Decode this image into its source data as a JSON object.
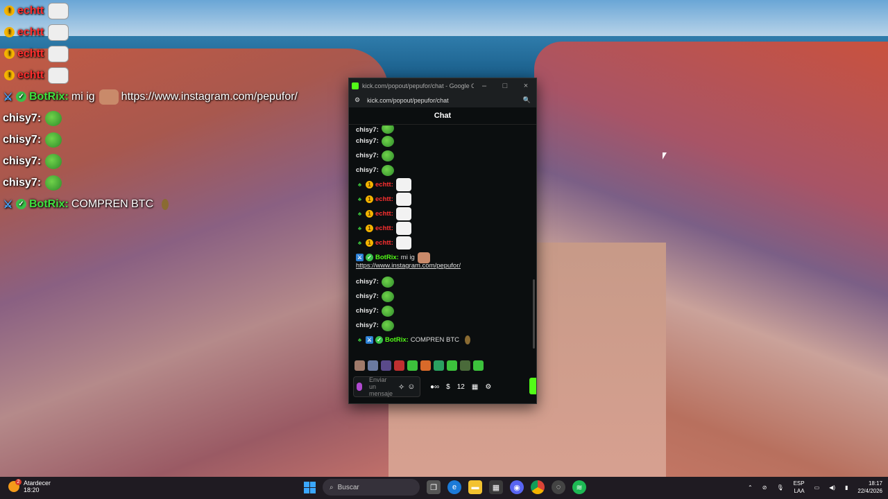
{
  "overlay": {
    "rows": [
      {
        "user": "echtt",
        "color": "red",
        "badges": [
          "gold"
        ],
        "text": ""
      },
      {
        "user": "echtt",
        "color": "red",
        "badges": [
          "gold"
        ],
        "text": ""
      },
      {
        "user": "echtt",
        "color": "red",
        "badges": [
          "gold"
        ],
        "text": ""
      },
      {
        "user": "echtt",
        "color": "red",
        "badges": [
          "gold"
        ],
        "text": ""
      },
      {
        "user": "BotRix:",
        "color": "green",
        "badges": [
          "blue",
          "green"
        ],
        "text": "mi ig",
        "link": "https://www.instagram.com/pepufor/"
      },
      {
        "user": "chisy7:",
        "color": "white",
        "badges": [],
        "text": ""
      },
      {
        "user": "chisy7:",
        "color": "white",
        "badges": [],
        "text": ""
      },
      {
        "user": "chisy7:",
        "color": "white",
        "badges": [],
        "text": ""
      },
      {
        "user": "chisy7:",
        "color": "white",
        "badges": [],
        "text": ""
      },
      {
        "user": "BotRix:",
        "color": "green",
        "badges": [
          "blue",
          "green"
        ],
        "text": "COMPREN BTC"
      }
    ]
  },
  "window": {
    "title": "kick.com/popout/pepufor/chat - Google Ch...",
    "url": "kick.com/popout/pepufor/chat",
    "minimize": "–",
    "maximize": "□",
    "close": "×",
    "chat_header": "Chat"
  },
  "messages": {
    "chisy_top": "chisy7:",
    "chisy": "chisy7:",
    "echtt": "echtt:",
    "botrix": "BotRix:",
    "botrix_ig_text": "mi ig",
    "ig_link": "https://www.instagram.com/pepufor/",
    "botrix_btc_text": "COMPREN BTC"
  },
  "composer": {
    "placeholder": "Enviar un mensaje",
    "count": "12"
  },
  "taskbar": {
    "weather_label": "Atardecer",
    "weather_time": "18:20",
    "weather_badge": "2",
    "search_placeholder": "Buscar",
    "lang_top": "ESP",
    "lang_bottom": "LAA",
    "time": "18:17",
    "date": "22/4/2026"
  }
}
